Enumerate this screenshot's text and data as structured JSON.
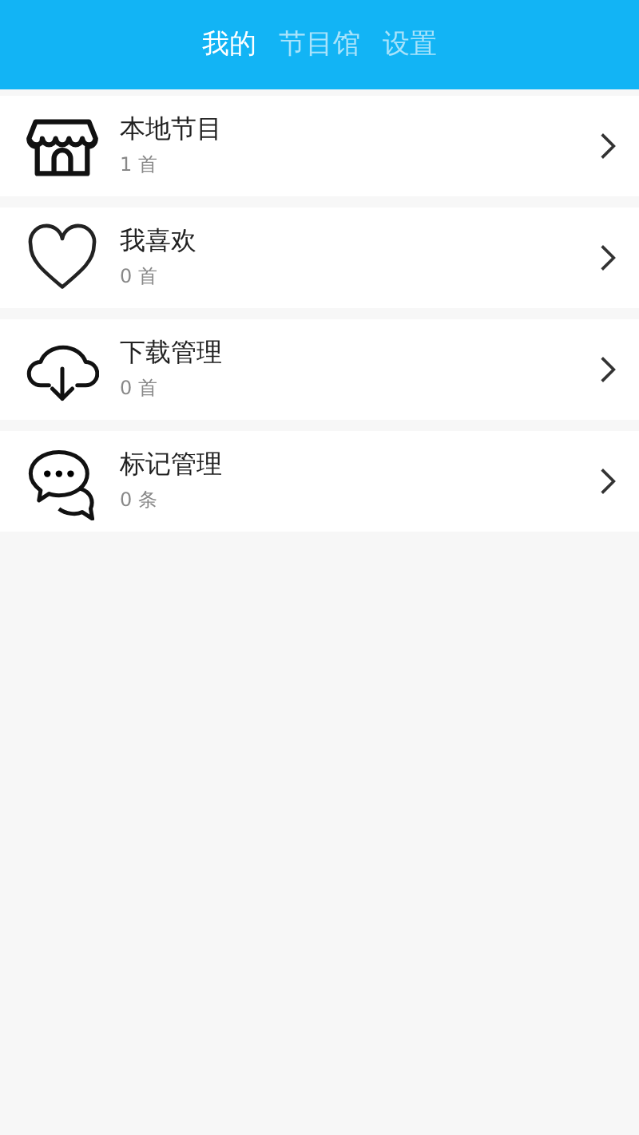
{
  "tabs": [
    {
      "label": "我的",
      "selected": true
    },
    {
      "label": "节目馆",
      "selected": false
    },
    {
      "label": "设置",
      "selected": false
    }
  ],
  "items": [
    {
      "kind": "store",
      "title": "本地节目",
      "count": "1 首"
    },
    {
      "kind": "heart",
      "title": "我喜欢",
      "count": "0 首"
    },
    {
      "kind": "download",
      "title": "下载管理",
      "count": "0 首"
    },
    {
      "kind": "chat",
      "title": "标记管理",
      "count": "0 条"
    }
  ]
}
